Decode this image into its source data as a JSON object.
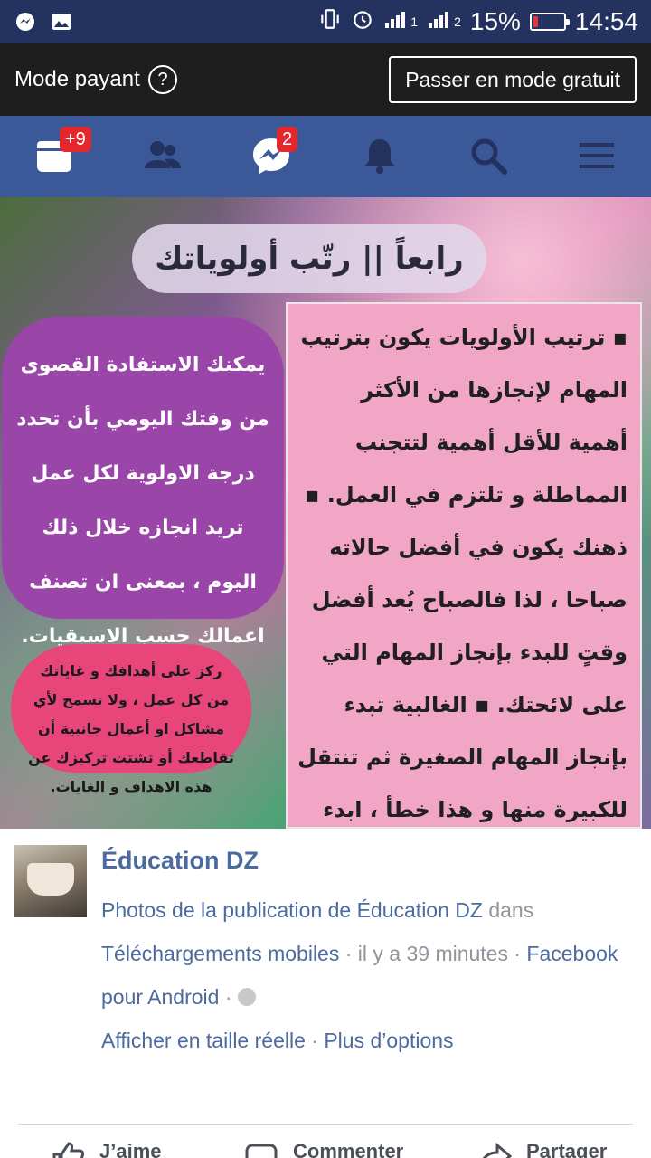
{
  "status_bar": {
    "battery_text": "15%",
    "battery_level": 0.15,
    "time": "14:54",
    "sim1": "1",
    "sim2": "2",
    "icons": [
      "messenger-icon",
      "gallery-icon",
      "vibrate-icon",
      "alarm-icon",
      "signal-icon",
      "signal-icon"
    ]
  },
  "mode_bar": {
    "label": "Mode payant",
    "help_glyph": "?",
    "switch_button": "Passer en mode gratuit"
  },
  "nav": {
    "items": [
      {
        "icon": "feed-icon",
        "badge": "+9"
      },
      {
        "icon": "friends-icon",
        "badge": ""
      },
      {
        "icon": "messenger-icon",
        "badge": "2"
      },
      {
        "icon": "bell-icon",
        "badge": ""
      },
      {
        "icon": "search-icon",
        "badge": ""
      },
      {
        "icon": "menu-icon",
        "badge": ""
      }
    ],
    "colors": {
      "bar": "#3b5998",
      "badge": "#e4262d"
    }
  },
  "photo": {
    "title": "رابعاً || رتّب أولوياتك",
    "right_panel": "▪ ترتيب الأولويات يكون بترتيب المهام لإنجازها من الأكثر أهمية للأقل أهمية لتتجنب المماطلة و تلتزم في العمل. ▪ ذهنك يكون في أفضل حالاته صباحا ، لذا فالصباح يُعد أفضل وقتٍ للبدء بإنجاز المهام التي على لائحتك. ▪ الغالبية تبدء بإنجاز المهام الصغيرة ثم تنتقل للكبيرة منها و هذا خطأ ، ابدء بالكبيرة منها كي لا تتشتت في العمل و حتى لا تؤجّله إلى يومٍ آخر.",
    "purple_panel": "يمكنك الاستفادة القصوى من وقتك اليومي بأن تحدد درجة الاولوية لكل عمل تريد انجازه خلال ذلك اليوم ، بمعنى ان تصنف اعمالك حسب الاسبقيات.",
    "pink_panel": "ركز على أهدافك و غاياتك من كل عمل ، ولا تسمح لأي مشاكل او أعمال جانبية أن تقاطعك أو تشتت تركيزك عن هذه الاهداف و الغايات."
  },
  "post": {
    "author": "Éducation DZ",
    "line1_link": "Photos de la publication de Éducation DZ",
    "line1_rest": " dans",
    "line2_link": "Téléchargements mobiles",
    "line2_time": " · il y a 39 minutes · ",
    "line2_source": "Facebook",
    "line3_source": "pour Android",
    "line3_dot": " · ",
    "line4_link1": "Afficher en taille réelle",
    "line4_sep": " · ",
    "line4_link2": "Plus d’options"
  },
  "actions": {
    "like": "J’aime",
    "comment": "Commenter",
    "share": "Partager"
  }
}
